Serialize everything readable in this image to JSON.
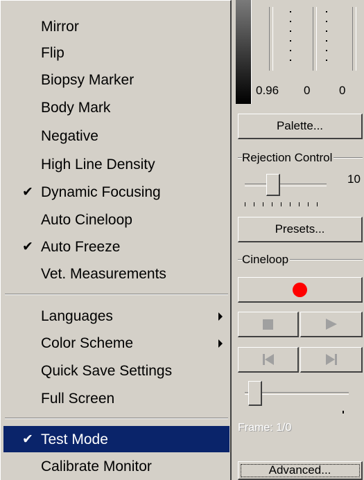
{
  "menu": {
    "items": [
      {
        "label": "Mirror",
        "checked": false
      },
      {
        "label": "Flip",
        "checked": false
      },
      {
        "label": "Biopsy Marker",
        "checked": false
      },
      {
        "label": "Body Mark",
        "checked": false
      },
      {
        "label": "Negative",
        "checked": false
      },
      {
        "label": "High Line Density",
        "checked": false
      },
      {
        "label": "Dynamic Focusing",
        "checked": true
      },
      {
        "label": "Auto Cineloop",
        "checked": false
      },
      {
        "label": "Auto Freeze",
        "checked": true
      },
      {
        "label": "Vet. Measurements",
        "checked": false
      },
      {
        "label": "Languages",
        "submenu": true
      },
      {
        "label": "Color Scheme",
        "submenu": true
      },
      {
        "label": "Quick Save Settings"
      },
      {
        "label": "Full Screen"
      },
      {
        "label": "Test Mode",
        "checked": true,
        "highlighted": true
      },
      {
        "label": "Calibrate Monitor"
      }
    ],
    "check_glyph": "✔"
  },
  "panel": {
    "values": [
      "0.96",
      "0",
      "0"
    ],
    "palette_label": "Palette...",
    "rejection_label": "Rejection Control",
    "rejection_value": "10",
    "presets_label": "Presets...",
    "cineloop_label": "Cineloop",
    "frame_text": "Frame: 1/0",
    "advanced_label": "Advanced..."
  },
  "icons": {
    "record": "record-icon",
    "stop": "stop-icon",
    "play": "play-icon",
    "first": "first-frame-icon",
    "last": "last-frame-icon"
  },
  "colors": {
    "highlight": "#0a246a",
    "record": "#ff0000"
  }
}
